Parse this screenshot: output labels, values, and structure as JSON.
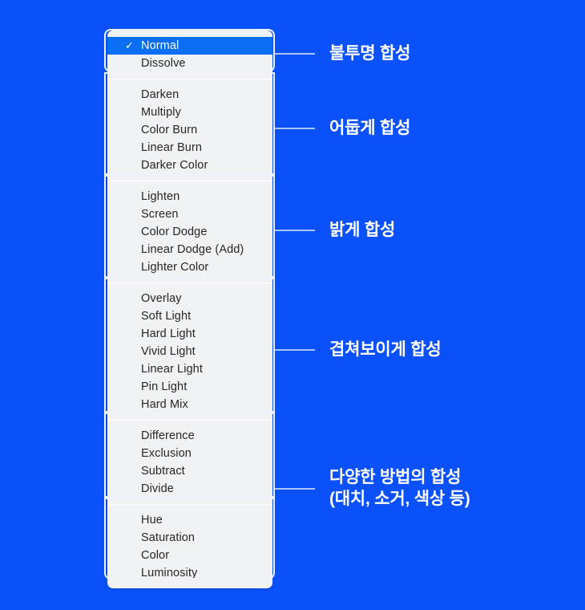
{
  "background_color": "#0a51fb",
  "menu": {
    "name": "blend-mode-menu",
    "selected_item": "Normal",
    "check_glyph": "✓",
    "groups": [
      {
        "group_name": "opaque-blend-group",
        "items": [
          "Normal",
          "Dissolve"
        ]
      },
      {
        "group_name": "darken-blend-group",
        "items": [
          "Darken",
          "Multiply",
          "Color Burn",
          "Linear Burn",
          "Darker Color"
        ]
      },
      {
        "group_name": "lighten-blend-group",
        "items": [
          "Lighten",
          "Screen",
          "Color Dodge",
          "Linear Dodge (Add)",
          "Lighter Color"
        ]
      },
      {
        "group_name": "contrast-blend-group",
        "items": [
          "Overlay",
          "Soft Light",
          "Hard Light",
          "Vivid Light",
          "Linear Light",
          "Pin Light",
          "Hard Mix"
        ]
      },
      {
        "group_name": "comparative-blend-group",
        "items": [
          "Difference",
          "Exclusion",
          "Subtract",
          "Divide"
        ]
      },
      {
        "group_name": "component-blend-group",
        "items": [
          "Hue",
          "Saturation",
          "Color",
          "Luminosity"
        ]
      }
    ]
  },
  "annotations": [
    {
      "name": "annotation-opaque",
      "text": "불투명 합성"
    },
    {
      "name": "annotation-darken",
      "text": "어둡게 합성"
    },
    {
      "name": "annotation-lighten",
      "text": "밝게 합성"
    },
    {
      "name": "annotation-contrast",
      "text": "겹쳐보이게 합성"
    },
    {
      "name": "annotation-comparative",
      "text": "다양한 방법의 합성\n(대치, 소거, 색상 등)"
    }
  ],
  "colors": {
    "background": "#0a51fb",
    "menu_background": "#f1f2f3",
    "selected_row": "#0a6ef2",
    "item_text": "#262626",
    "selected_text": "#ffffff",
    "connector_line": "#a9c6f7",
    "bracket_outline": "#eef3fb",
    "annotation_text": "#ffffff"
  }
}
